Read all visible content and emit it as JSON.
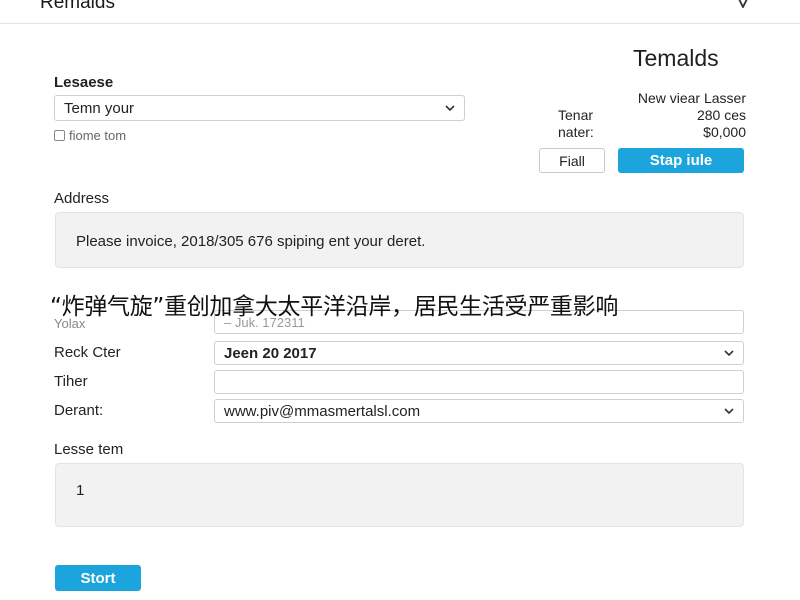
{
  "app": {
    "title": "Remalds"
  },
  "panel": {
    "title": "Temalds"
  },
  "lease": {
    "label": "Lesaese",
    "select_value": "Temn your",
    "checkbox_label": "fiome tom"
  },
  "info": {
    "header": "New viear Lasser",
    "rows": [
      {
        "key": "Tenar",
        "value": "280 ces"
      },
      {
        "key": "nater:",
        "value": "$0,000"
      }
    ]
  },
  "buttons": {
    "secondary": "Fiall",
    "primary": "Stap iule",
    "start": "Stort"
  },
  "address": {
    "label": "Address",
    "text": "Please invoice, 2018/305 676 spiping ent your deret."
  },
  "caption": "“炸弹气旋”重创加拿大太平洋沿岸，居民生活受严重影响",
  "form": {
    "row1": {
      "label": "Yolax",
      "placeholder": "– Juk. 172311"
    },
    "row2": {
      "label": "Reck Cter",
      "value": "Jeen 20 2017"
    },
    "row3": {
      "label": "Tiher",
      "value": ""
    },
    "row4": {
      "label": "Derant:",
      "value": "www.piv@mmasmertalsl.com"
    }
  },
  "lease_term": {
    "label": "Lesse tem",
    "value": "1"
  },
  "icons": {
    "app": "shield-icon",
    "dropdown": "chevron-down-icon"
  },
  "colors": {
    "primary": "#1ca4dc",
    "field_bg": "#f2f2f2",
    "border": "#cfcfcf"
  }
}
